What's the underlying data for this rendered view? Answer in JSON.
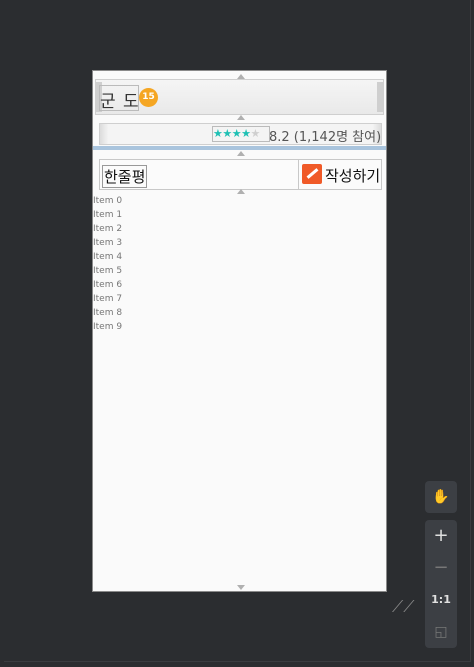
{
  "title": {
    "text": "군 도",
    "badge": "15"
  },
  "rating": {
    "stars_filled": 4,
    "stars_total": 5,
    "text": "8.2 (1,142명 참여)"
  },
  "review": {
    "label": "한줄평",
    "write_label": "작성하기"
  },
  "list": [
    "Item 0",
    "Item 1",
    "Item 2",
    "Item 3",
    "Item 4",
    "Item 5",
    "Item 6",
    "Item 7",
    "Item 8",
    "Item 9"
  ],
  "tools": {
    "pan": "✋",
    "zoom_in": "+",
    "zoom_out": "−",
    "actual": "1:1",
    "fit": "◱"
  },
  "colors": {
    "badge": "#f5a623",
    "stars": "#1ec0b4",
    "write_icon": "#f05a28",
    "divider": "#a9c4dd"
  }
}
